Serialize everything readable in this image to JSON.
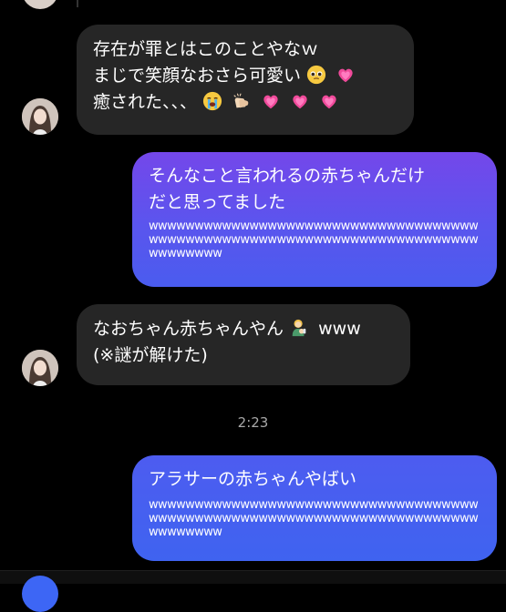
{
  "messages": [
    {
      "id": "m1",
      "direction": "incoming",
      "lines": [
        "存在が罪とはこのことやなｗ",
        "まじで笑顔なおさら可愛い",
        "癒された、、、"
      ],
      "emoji_line2": [
        "pleading-face",
        "growing-heart"
      ],
      "emoji_line3": [
        "crying-face",
        "clapping-hands",
        "growing-heart",
        "growing-heart",
        "growing-heart"
      ]
    },
    {
      "id": "m2",
      "direction": "outgoing",
      "lines": [
        "そんなこと言われるの赤ちゃんだけ",
        "だと思ってました"
      ],
      "w_run": "wwwwwwwwwwwwwwwwwwwwwwwwwwwwwwwwwwwwwwwwwwwwwwwwwwwwwwwwwwwwwwwwwwwwwwwwwwwwwwww"
    },
    {
      "id": "m3",
      "direction": "incoming",
      "line1_text": "なおちゃん赤ちゃんやん",
      "line1_suffix": "www",
      "line1_emoji": "person-feeding-baby",
      "line2": "(※謎が解けた)"
    },
    {
      "id": "m4",
      "direction": "outgoing",
      "lines": [
        "アラサーの赤ちゃんやばい"
      ],
      "w_run": "wwwwwwwwwwwwwwwwwwwwwwwwwwwwwwwwwwwwwwwwwwwwwwwwwwwwwwwwwwwwwwwwwwwwwwwwwwwwwwww"
    }
  ],
  "timestamp": "2:23",
  "colors": {
    "background": "#000000",
    "incoming_bubble": "#262626",
    "outgoing_gradient_top": "#7447ea",
    "outgoing_gradient_bottom": "#3f63f0",
    "timestamp": "#a8a8a8"
  }
}
